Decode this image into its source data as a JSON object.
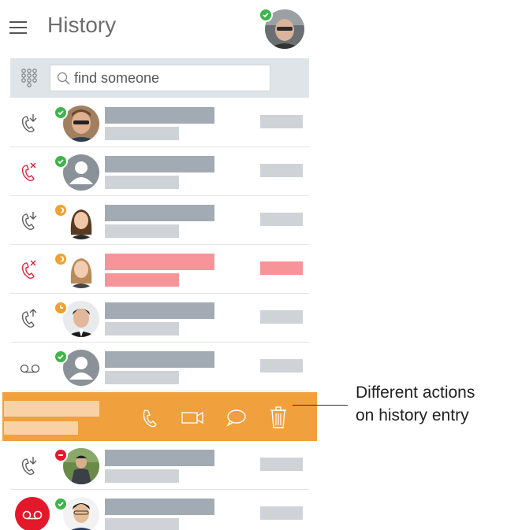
{
  "header": {
    "title": "History",
    "self_status": "available"
  },
  "search": {
    "placeholder": "find someone"
  },
  "colors": {
    "accent_orange": "#f0a03c",
    "missed_red": "#e3192b",
    "status_green": "#3db54a",
    "status_orange": "#f0a030"
  },
  "entries": [
    {
      "call_type": "incoming",
      "status": "available"
    },
    {
      "call_type": "missed",
      "status": "available"
    },
    {
      "call_type": "incoming",
      "status": "away"
    },
    {
      "call_type": "missed",
      "status": "away"
    },
    {
      "call_type": "outgoing",
      "status": "away-clock"
    },
    {
      "call_type": "voicemail",
      "status": "available"
    },
    {
      "call_type": "selected",
      "status": "none"
    },
    {
      "call_type": "incoming",
      "status": "do-not-disturb"
    },
    {
      "call_type": "voicemail-unread",
      "status": "available"
    }
  ],
  "actions": [
    "phone-icon",
    "video-icon",
    "chat-icon",
    "trash-icon"
  ],
  "callout": {
    "line1": "Different actions",
    "line2": "on history entry"
  }
}
